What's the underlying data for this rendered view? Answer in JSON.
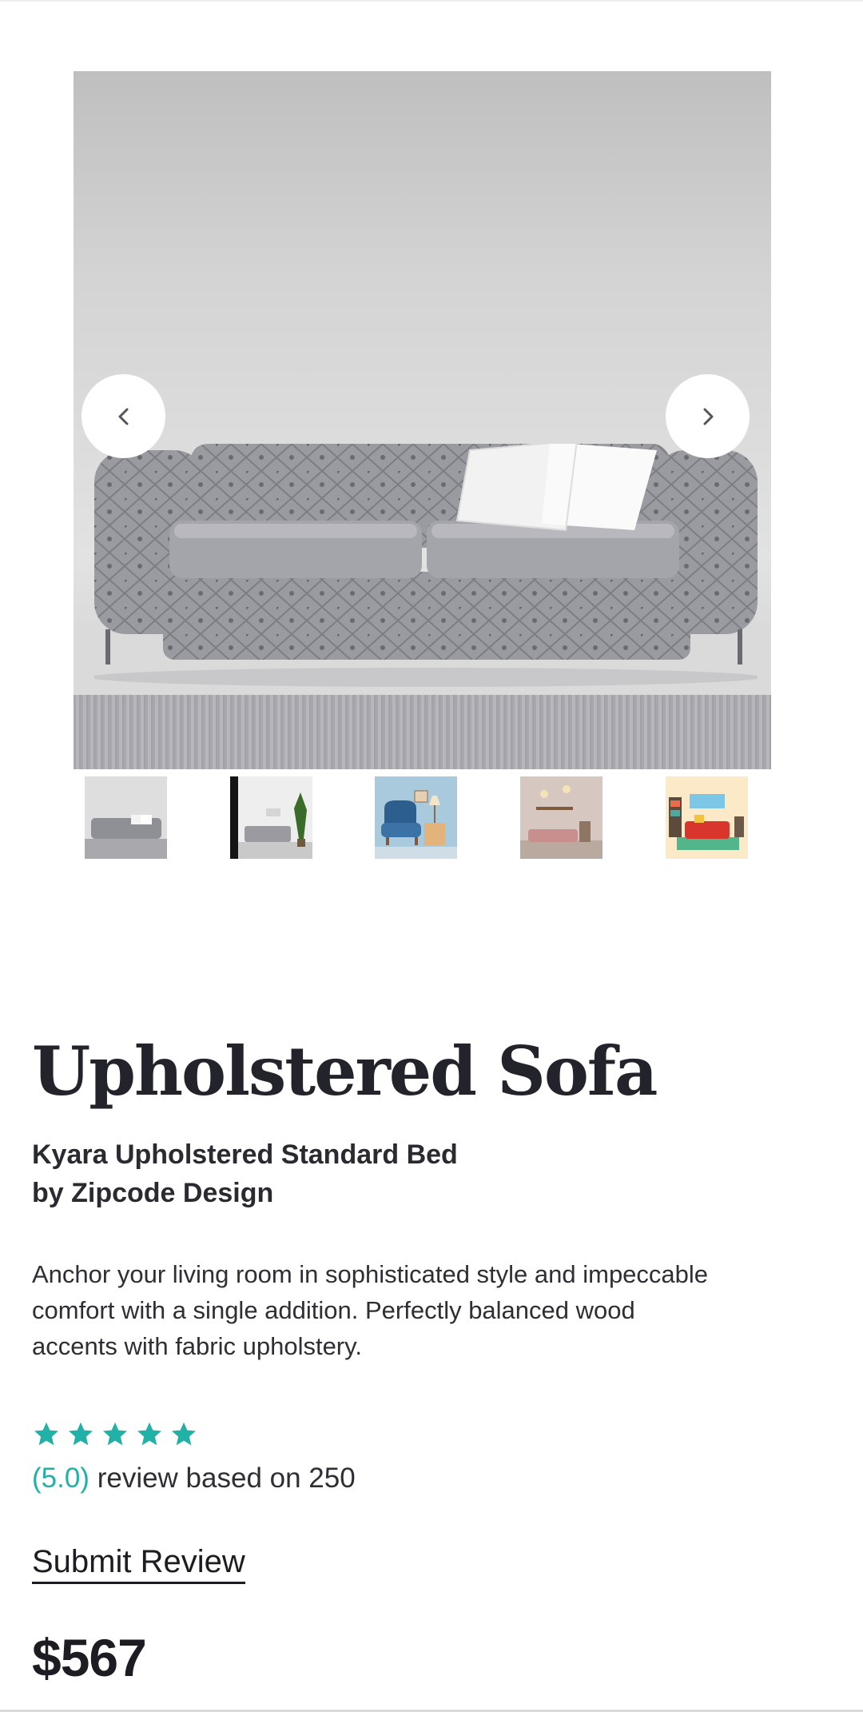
{
  "product": {
    "title": "Upholstered Sofa",
    "subtitle_line1": "Kyara Upholstered Standard Bed",
    "subtitle_line2": "by Zipcode Design",
    "description": "Anchor your living room in sophisticated style and impeccable comfort with a single addition. Perfectly balanced wood accents with fabric upholstery.",
    "rating_value": "(5.0)",
    "rating_text": " review based on 250",
    "rating_stars": 5,
    "submit_review_label": "Submit Review",
    "price": "$567"
  },
  "gallery": {
    "main_image": "grey-tufted-sofa",
    "thumbnails": [
      "grey-sofa-thumb",
      "living-room-plant-thumb",
      "blue-armchair-thumb",
      "pink-lounge-thumb",
      "red-sofa-room-thumb"
    ],
    "prev_icon": "chevron-left-icon",
    "next_icon": "chevron-right-icon"
  },
  "colors": {
    "accent": "#21b1a6",
    "text": "#23232b"
  }
}
